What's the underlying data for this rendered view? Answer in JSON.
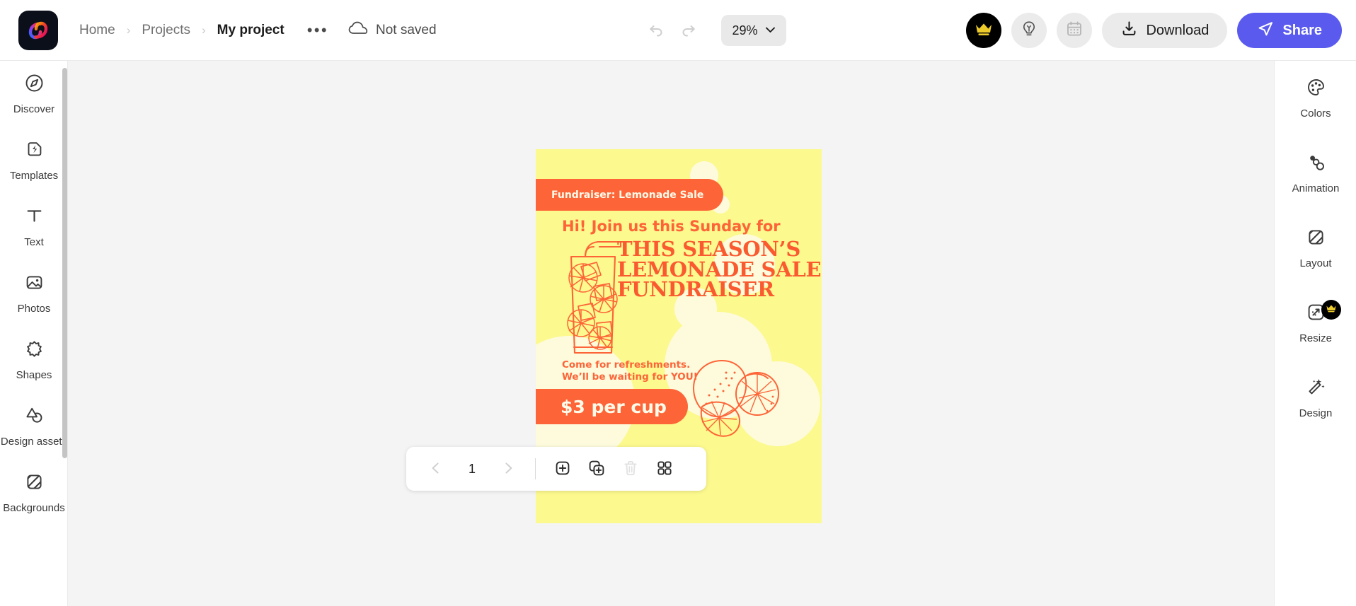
{
  "app": {
    "logo_name": "adobe-express-logo"
  },
  "header": {
    "breadcrumb": [
      {
        "label": "Home",
        "current": false
      },
      {
        "label": "Projects",
        "current": false
      },
      {
        "label": "My project",
        "current": true
      }
    ],
    "breadcrumb_separator": "›",
    "more_options": "•••",
    "save_status": "Not saved",
    "save_icon": "cloud-icon",
    "undo_icon": "undo-icon",
    "redo_icon": "redo-icon",
    "zoom_value": "29%",
    "zoom_chevron": "chevron-down-icon",
    "premium_badge": "crown-icon",
    "ideas_icon": "lightbulb-icon",
    "schedule_icon": "calendar-icon",
    "download_label": "Download",
    "download_icon": "download-icon",
    "share_label": "Share",
    "share_icon": "send-icon"
  },
  "left_rail": {
    "items": [
      {
        "label": "Discover",
        "icon": "compass-icon"
      },
      {
        "label": "Templates",
        "icon": "templates-icon"
      },
      {
        "label": "Text",
        "icon": "text-icon"
      },
      {
        "label": "Photos",
        "icon": "photo-icon"
      },
      {
        "label": "Shapes",
        "icon": "shapes-icon"
      },
      {
        "label": "Design assets",
        "icon": "design-assets-icon"
      },
      {
        "label": "Backgrounds",
        "icon": "backgrounds-icon"
      }
    ]
  },
  "right_rail": {
    "items": [
      {
        "label": "Colors",
        "icon": "palette-icon",
        "pro": false
      },
      {
        "label": "Animation",
        "icon": "animation-icon",
        "pro": false
      },
      {
        "label": "Layout",
        "icon": "layout-icon",
        "pro": false
      },
      {
        "label": "Resize",
        "icon": "resize-icon",
        "pro": true
      },
      {
        "label": "Design",
        "icon": "magic-wand-icon",
        "pro": false
      }
    ],
    "pro_badge_icon": "crown-icon"
  },
  "poster": {
    "tag": "Fundraiser: Lemonade Sale",
    "greeting": "Hi! Join us this Sunday for",
    "headline": "THIS SEASON’S LEMONADE SALE FUNDRAISER",
    "subtext_line1": "Come for refreshments.",
    "subtext_line2": "We’ll be waiting for YOU!",
    "price": "$3 per cup",
    "art_glass": "lemonade-glass-illustration",
    "art_lemons": "lemon-slices-illustration",
    "colors": {
      "background": "#fcf98e",
      "accent": "#fd6438",
      "headline": "#fa5a30",
      "bubble": "#fdfbdc",
      "pill_text": "#fffbe9"
    }
  },
  "page_toolbar": {
    "prev_icon": "chevron-left-icon",
    "next_icon": "chevron-right-icon",
    "page_number": "1",
    "add_page_icon": "add-page-icon",
    "duplicate_page_icon": "duplicate-page-icon",
    "delete_page_icon": "trash-icon",
    "grid_view_icon": "grid-view-icon"
  },
  "theme": {
    "canvas_background": "#f4f4f4",
    "share_button": "#5a5aef",
    "chrome_background": "#ffffff"
  }
}
